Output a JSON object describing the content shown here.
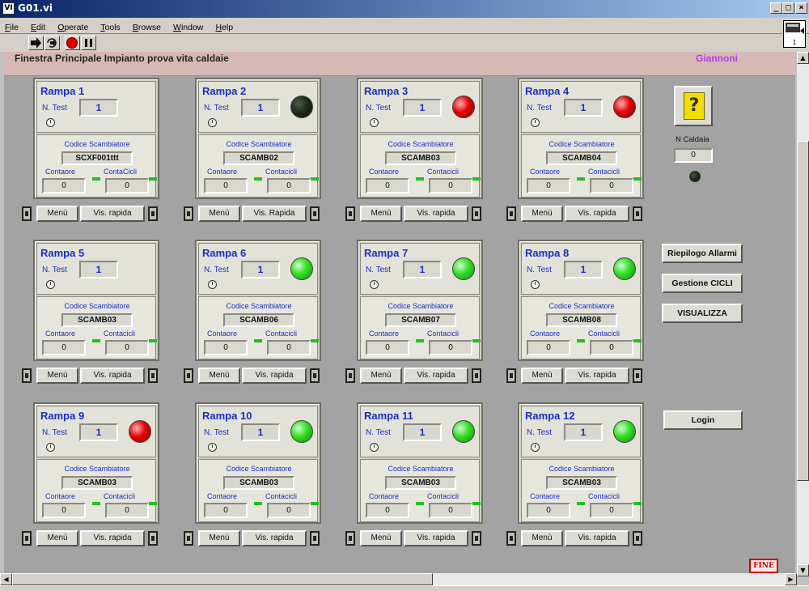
{
  "window": {
    "title": "G01.vi",
    "icon_label": "VI",
    "controls": {
      "minimize": "_",
      "maximize": "□",
      "close": "×"
    }
  },
  "menu": [
    "File",
    "Edit",
    "Operate",
    "Tools",
    "Browse",
    "Window",
    "Help"
  ],
  "toolbar": {
    "buttons": [
      "run-arrow-icon",
      "run-continuous-icon",
      "abort-stop-icon",
      "pause-icon"
    ]
  },
  "vi_icon": {
    "label": "1"
  },
  "header": {
    "title": "Finestra Principale Impianto prova vita caldaie",
    "user": "Giannoni"
  },
  "labels": {
    "n_test": "N. Test",
    "codice": "Codice Scambiatore",
    "contaore": "Contaore",
    "contacicli": "Contacicli",
    "menu_button": "Menù",
    "vis_button": "Vis. rapida"
  },
  "rampe": [
    {
      "title": "Rampa 1",
      "n_test": "1",
      "codice": "SCXF001ttt",
      "contaore": "0",
      "contacicli": "0",
      "contacicli_label": "ContaCicli",
      "vis_label": "Vis. rapida",
      "led": "none"
    },
    {
      "title": "Rampa 2",
      "n_test": "1",
      "codice": "SCAMB02",
      "contaore": "0",
      "contacicli": "0",
      "contacicli_label": "Contacicli",
      "vis_label": "Vis. Rapida",
      "led": "dark"
    },
    {
      "title": "Rampa 3",
      "n_test": "1",
      "codice": "SCAMB03",
      "contaore": "0",
      "contacicli": "0",
      "contacicli_label": "Contacicli",
      "vis_label": "Vis. rapida",
      "led": "red"
    },
    {
      "title": "Rampa 4",
      "n_test": "1",
      "codice": "SCAMB04",
      "contaore": "0",
      "contacicli": "0",
      "contacicli_label": "Contacicli",
      "vis_label": "Vis. rapida",
      "led": "red"
    },
    {
      "title": "Rampa 5",
      "n_test": "1",
      "codice": "SCAMB03",
      "contaore": "0",
      "contacicli": "0",
      "contacicli_label": "Contacicli",
      "vis_label": "Vis. rapida",
      "led": "none"
    },
    {
      "title": "Rampa 6",
      "n_test": "1",
      "codice": "SCAMB06",
      "contaore": "0",
      "contacicli": "0",
      "contacicli_label": "Contacicli",
      "vis_label": "Vis. rapida",
      "led": "green"
    },
    {
      "title": "Rampa 7",
      "n_test": "1",
      "codice": "SCAMB07",
      "contaore": "0",
      "contacicli": "0",
      "contacicli_label": "Contacicli",
      "vis_label": "Vis. rapida",
      "led": "green"
    },
    {
      "title": "Rampa 8",
      "n_test": "1",
      "codice": "SCAMB08",
      "contaore": "0",
      "contacicli": "0",
      "contacicli_label": "Contacicli",
      "vis_label": "Vis. rapida",
      "led": "green"
    },
    {
      "title": "Rampa 9",
      "n_test": "1",
      "codice": "SCAMB03",
      "contaore": "0",
      "contacicli": "0",
      "contacicli_label": "Contacicli",
      "vis_label": "Vis. rapida",
      "led": "red"
    },
    {
      "title": "Rampa 10",
      "n_test": "1",
      "codice": "SCAMB03",
      "contaore": "0",
      "contacicli": "0",
      "contacicli_label": "Contacicli",
      "vis_label": "Vis. rapida",
      "led": "green"
    },
    {
      "title": "Rampa 11",
      "n_test": "1",
      "codice": "SCAMB03",
      "contaore": "0",
      "contacicli": "0",
      "contacicli_label": "Contacicli",
      "vis_label": "Vis. rapida",
      "led": "green"
    },
    {
      "title": "Rampa 12",
      "n_test": "1",
      "codice": "SCAMB03",
      "contaore": "0",
      "contacicli": "0",
      "contacicli_label": "Contacicli",
      "vis_label": "Vis. rapida",
      "led": "green"
    }
  ],
  "side": {
    "help_glyph": "?",
    "n_caldaia_label": "N Caldaia",
    "n_caldaia_value": "0",
    "buttons": {
      "riepilogo": "Riepilogo Allarmi",
      "gestione": "Gestione CICLI",
      "visualizza": "VISUALIZZA",
      "login": "Login",
      "fine": "FINE"
    }
  },
  "colors": {
    "label_blue": "#1830c0",
    "header_bg": "#d6b9b4",
    "user_purple": "#b040e0",
    "panel_bg": "#a3a3a3",
    "fine_red": "#cc0000"
  }
}
